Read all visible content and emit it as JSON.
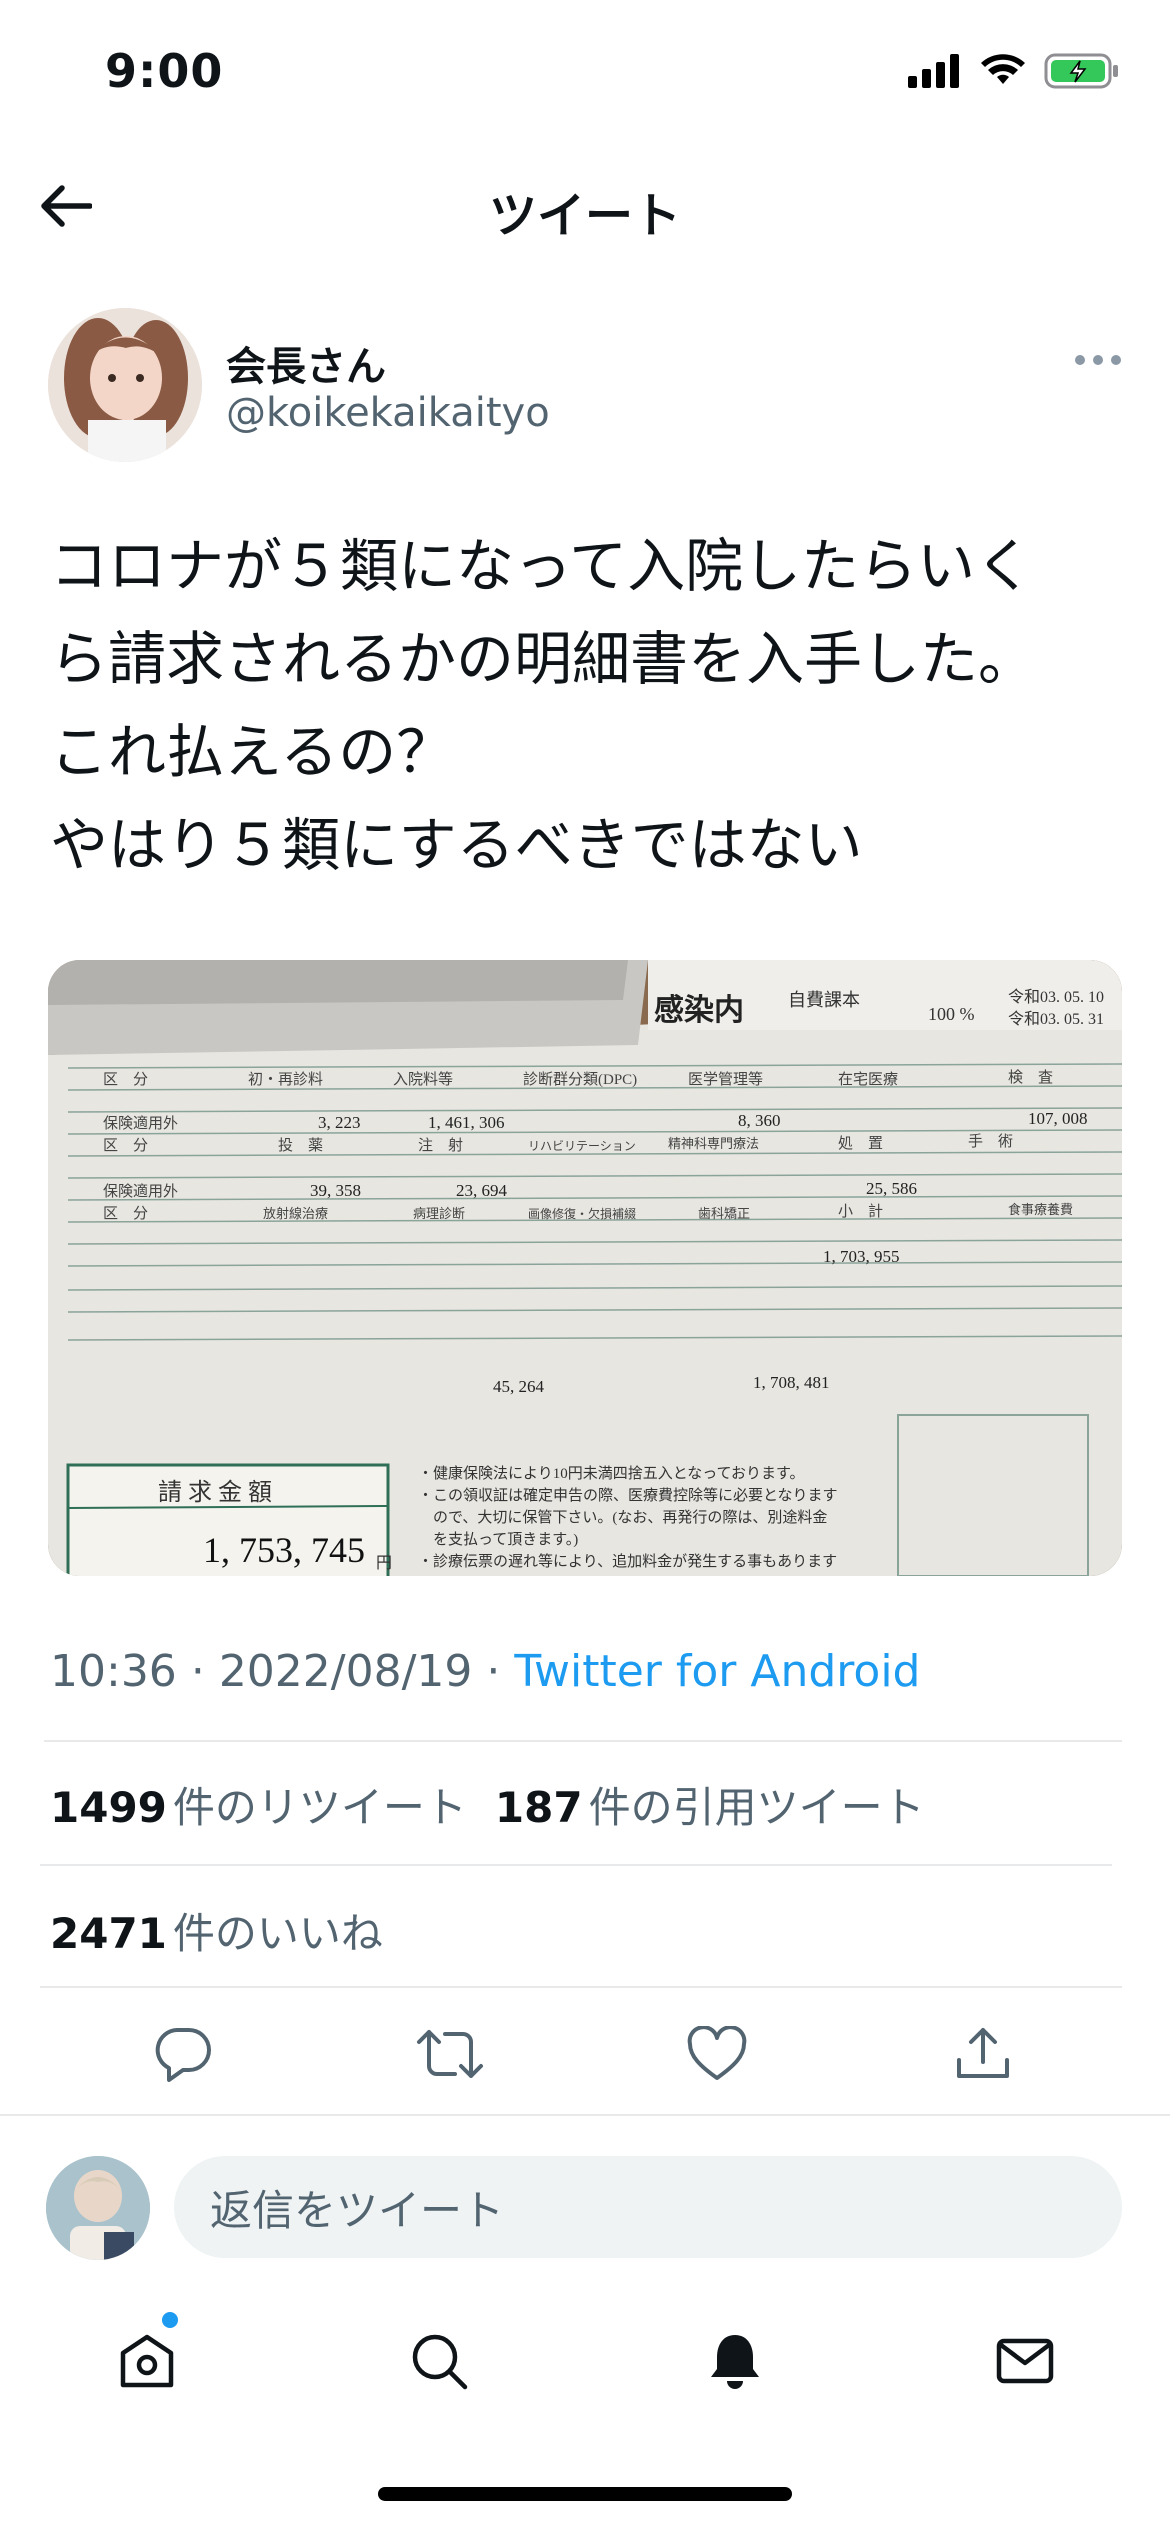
{
  "status_bar": {
    "time": "9:00"
  },
  "header": {
    "title": "ツイート"
  },
  "author": {
    "name": "会長さん",
    "handle": "@koikekaikaityo"
  },
  "tweet": {
    "text": "コロナが５類になって入院したらいく\nら請求されるかの明細書を入手した。\nこれ払えるの？\nやはり５類にするべきではない",
    "image": {
      "header_label": "感染内",
      "header_sub": "自費課本",
      "rate": "100 %",
      "dates": [
        "令和03. 05. 10",
        "令和03. 05. 31"
      ],
      "header_cells": [
        "区　分",
        "初・再診料",
        "入院料等",
        "診断群分類(DPC)",
        "医学管理等",
        "在宅医療",
        "検　査"
      ],
      "row1": [
        "保険適用外",
        "3, 223",
        "1, 461, 306",
        "",
        "8, 360",
        "",
        "107, 008"
      ],
      "header_cells2": [
        "区　分",
        "投　薬",
        "注　射",
        "リハビリテーション",
        "精神科専門療法",
        "処　置",
        "手　術"
      ],
      "row2": [
        "保険適用外",
        "39, 358",
        "23, 694",
        "",
        "",
        "25, 586",
        ""
      ],
      "header_cells3": [
        "区　分",
        "放射線治療",
        "病理診断",
        "画像修復・欠損補綴",
        "歯科矯正",
        "小　計",
        "食事療養費"
      ],
      "subtotal": "1, 703, 955",
      "meal": "45, 264",
      "out_of_insurance": "1, 708, 481",
      "billing_label": "請 求 金 額",
      "billing_total": "1, 753, 745",
      "yen": "円",
      "notes": [
        "・健康保険法により10円未満四捨五入となっております。",
        "・この領収証は確定申告の際、医療費控除等に必要となります",
        "　ので、大切に保管下さい。(なお、再発行の際は、別途料金",
        "　を支払って頂きます。)",
        "・診療伝票の遅れ等により、追加料金が発生する事もあります"
      ]
    }
  },
  "meta": {
    "time": "10:36",
    "date": "2022/08/19",
    "separator": "·",
    "source": "Twitter for Android"
  },
  "stats": {
    "retweets_count": "1499",
    "retweets_label": "件のリツイート",
    "quotes_count": "187",
    "quotes_label": "件の引用ツイート",
    "likes_count": "2471",
    "likes_label": "件のいいね"
  },
  "reply": {
    "placeholder": "返信をツイート"
  },
  "colors": {
    "accent": "#1d9bf0",
    "text": "#0f1419",
    "muted": "#536471",
    "divider": "#e7e9ea"
  },
  "icons": [
    "back-arrow-icon",
    "more-icon",
    "reply-icon",
    "retweet-icon",
    "like-icon",
    "share-icon",
    "home-icon",
    "search-icon",
    "notifications-icon",
    "messages-icon"
  ]
}
